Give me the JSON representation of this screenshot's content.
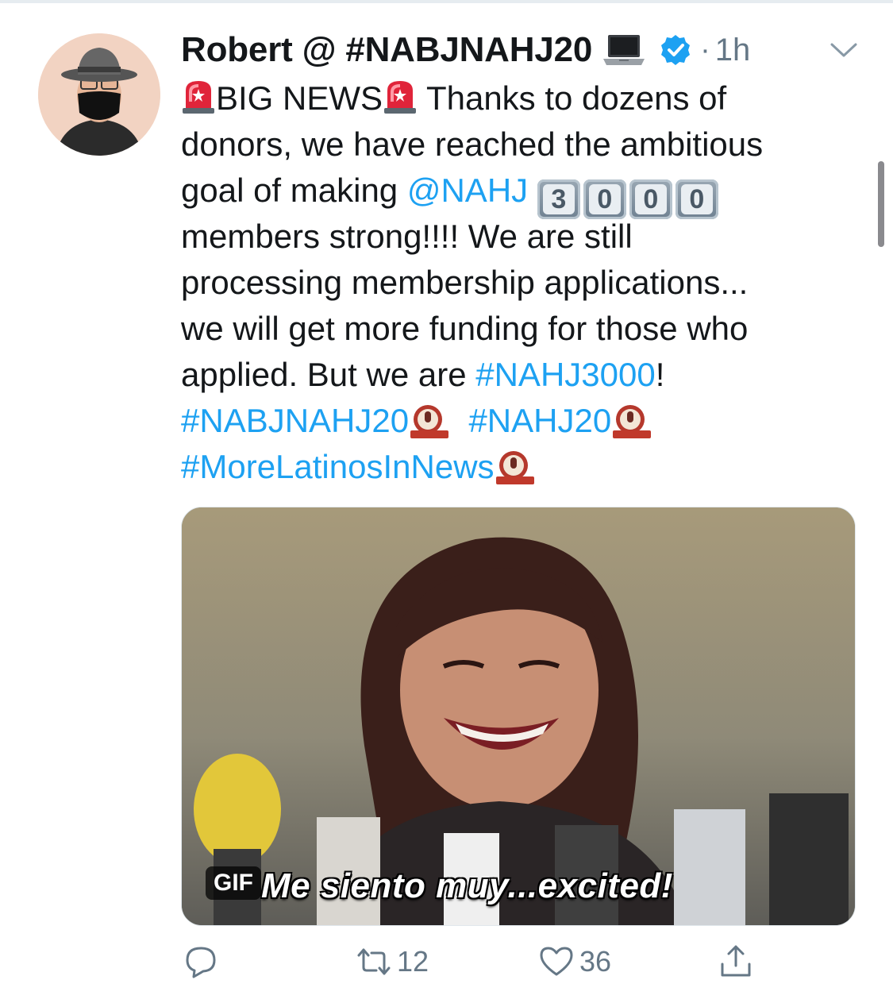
{
  "tweet": {
    "author_name": "Robert @ #NABJNAHJ20",
    "timestamp": "1h",
    "separator": "·",
    "text": {
      "line1_big_news": "BIG NEWS",
      "line1_rest": " Thanks to dozens of",
      "line2": "donors, we have reached the ambitious",
      "line3_start": "goal of making ",
      "mention": "@NAHJ",
      "keycaps": [
        "3",
        "0",
        "0",
        "0"
      ],
      "line4": "members strong!!!! We are still",
      "line5": "processing membership applications...",
      "line6": "we will get more funding for those who",
      "line7_start": "applied. But we are ",
      "hashtag_nahj3000": "#NAHJ3000",
      "line7_end": "!",
      "hashtag_nabjnahj20": "#NABJNAHJ20",
      "hashtag_nahj20": "#NAHJ20",
      "hashtag_morelatinos": "#MoreLatinosInNews"
    },
    "media": {
      "badge": "GIF",
      "caption": "Me siento muy...excited!"
    },
    "actions": {
      "reply_count": "",
      "retweet_count": "12",
      "like_count": "36"
    }
  },
  "icons": {
    "avatar": "avatar-man-hat-mask",
    "laptop": "laptop-icon",
    "verified": "verified-icon",
    "siren": "siren-icon",
    "mic": "microphone-icon",
    "chevron": "chevron-down-icon",
    "reply": "reply-icon",
    "retweet": "retweet-icon",
    "like": "heart-icon",
    "share": "share-icon"
  },
  "colors": {
    "link": "#1da1f2",
    "muted": "#657786",
    "verified": "#1da1f2"
  }
}
